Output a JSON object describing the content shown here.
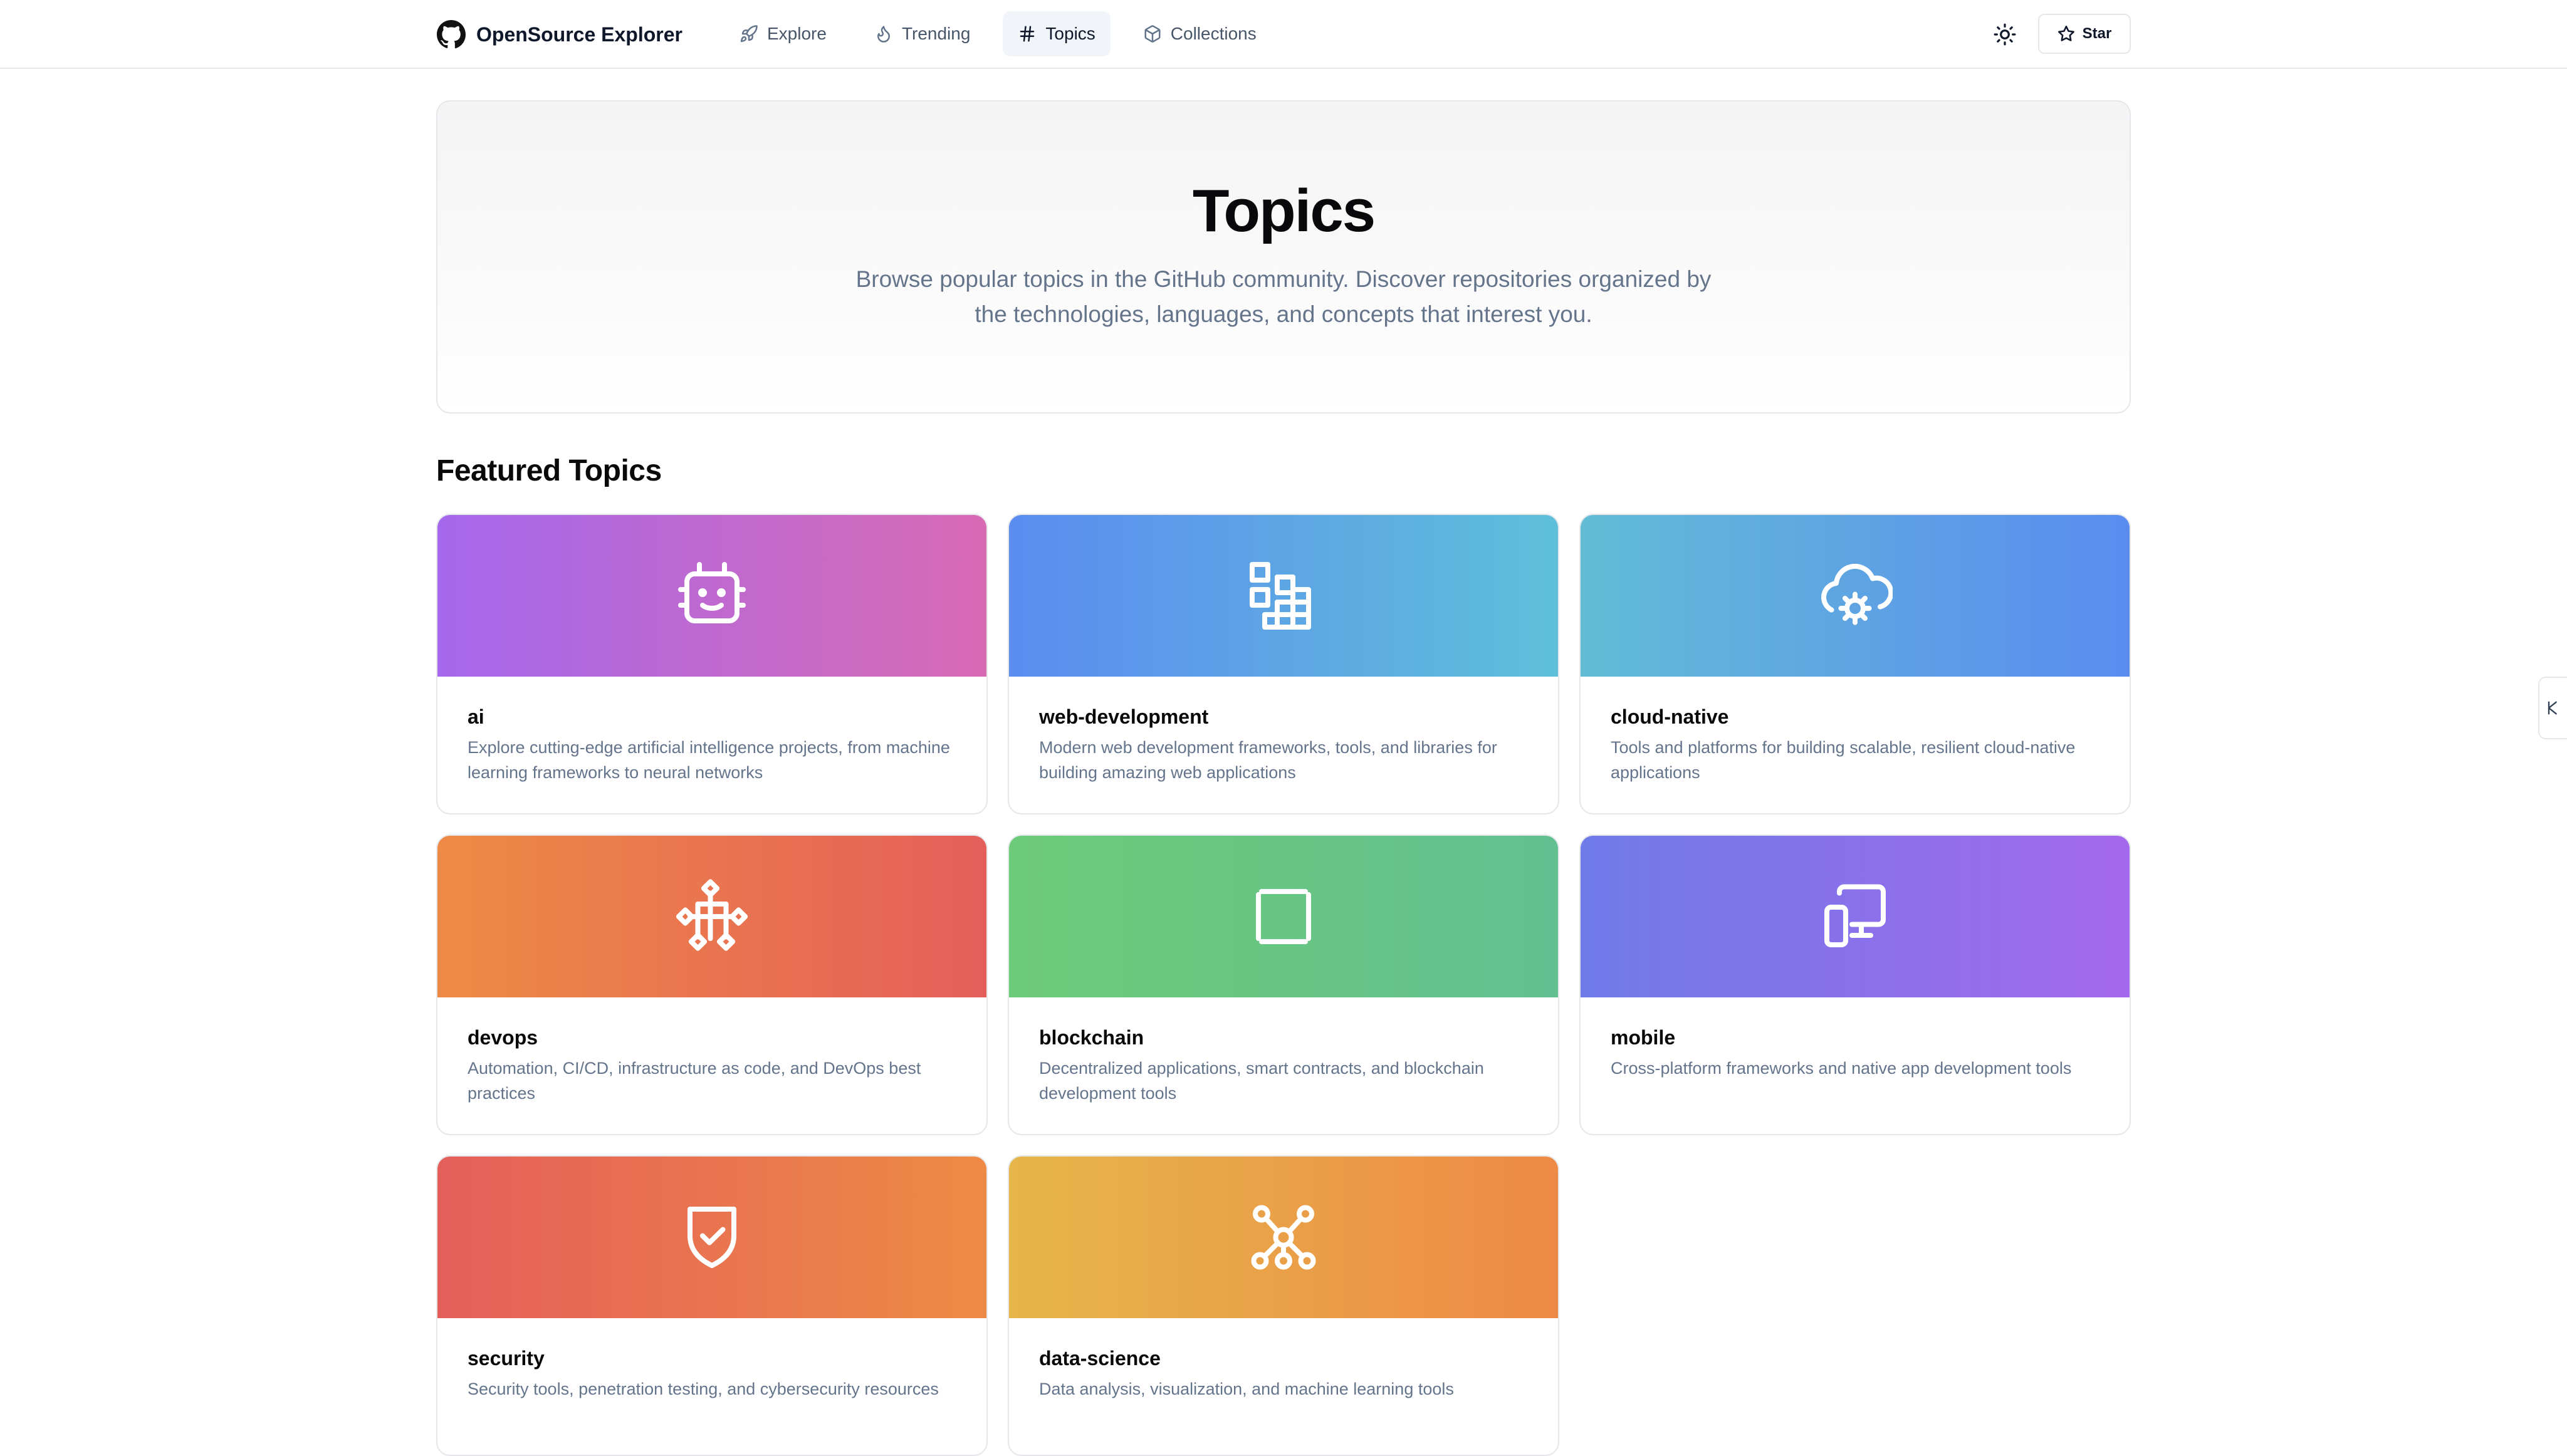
{
  "app": {
    "name": "OpenSource Explorer"
  },
  "nav": {
    "items": [
      {
        "label": "Explore",
        "icon": "rocket-icon",
        "active": false
      },
      {
        "label": "Trending",
        "icon": "flame-icon",
        "active": false
      },
      {
        "label": "Topics",
        "icon": "hash-icon",
        "active": true
      },
      {
        "label": "Collections",
        "icon": "box-icon",
        "active": false
      }
    ],
    "star_label": "Star"
  },
  "hero": {
    "title": "Topics",
    "subtitle": "Browse popular topics in the GitHub community. Discover repositories organized by the technologies, languages, and concepts that interest you."
  },
  "featured": {
    "title": "Featured Topics",
    "topics": [
      {
        "name": "ai",
        "description": "Explore cutting-edge artificial intelligence projects, from machine learning frameworks to neural networks",
        "icon": "bot-icon",
        "colors": [
          "#a568ec",
          "#d86ab4"
        ]
      },
      {
        "name": "web-development",
        "description": "Modern web development frameworks, tools, and libraries for building amazing web applications",
        "icon": "blocks-icon",
        "colors": [
          "#5b8cf0",
          "#5fbfd9"
        ]
      },
      {
        "name": "cloud-native",
        "description": "Tools and platforms for building scalable, resilient cloud-native applications",
        "icon": "cloud-cog-icon",
        "colors": [
          "#62bcd6",
          "#5a8cf0"
        ]
      },
      {
        "name": "devops",
        "description": "Automation, CI/CD, infrastructure as code, and DevOps best practices",
        "icon": "workflow-icon",
        "colors": [
          "#ee8a45",
          "#e45f5a"
        ]
      },
      {
        "name": "blockchain",
        "description": "Decentralized applications, smart contracts, and blockchain development tools",
        "icon": "frame-icon",
        "colors": [
          "#6ccb78",
          "#62c090"
        ]
      },
      {
        "name": "mobile",
        "description": "Cross-platform frameworks and native app development tools",
        "icon": "devices-icon",
        "colors": [
          "#6f7bea",
          "#a468ec"
        ]
      },
      {
        "name": "security",
        "description": "Security tools, penetration testing, and cybersecurity resources",
        "icon": "shield-check-icon",
        "colors": [
          "#e45f5a",
          "#ee8a45"
        ]
      },
      {
        "name": "data-science",
        "description": "Data analysis, visualization, and machine learning tools",
        "icon": "network-icon",
        "colors": [
          "#e6b64a",
          "#ee8a45"
        ]
      }
    ]
  }
}
